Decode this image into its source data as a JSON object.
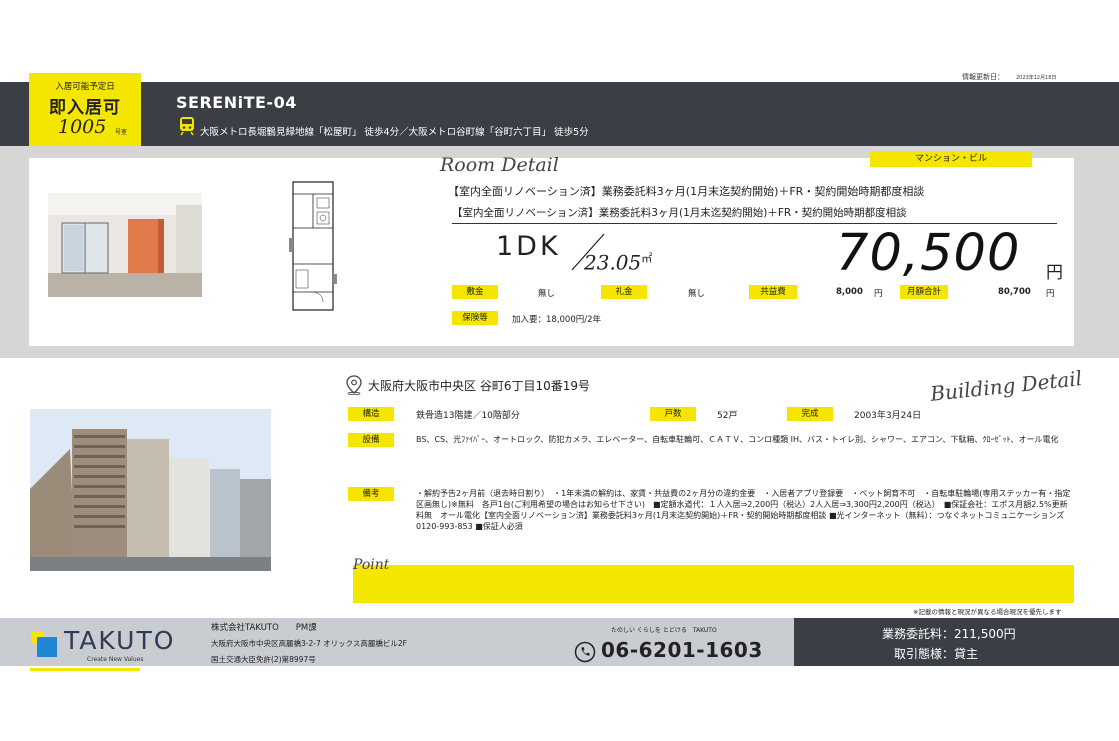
{
  "header": {
    "update_label": "情報更新日：",
    "update_date": "2023年12月18日",
    "property_name": "SERENiTE-04",
    "access": "大阪メトロ長堀鶴見緑地線「松屋町」 徒歩4分／大阪メトロ谷町線「谷町六丁目」 徒歩5分"
  },
  "badge": {
    "label": "入居可能予定日",
    "status": "即入居可",
    "room_number": "1005",
    "room_suffix": "号室"
  },
  "room": {
    "section_title": "Room Detail",
    "building_type": "マンション・ビル",
    "catch_line_1": "【室内全面リノベーション済】業務委託料3ヶ月(1月末迄契約開始)＋FR・契約開始時期都度相談",
    "catch_line_2": "【室内全面リノベーション済】業務委託料3ヶ月(1月末迄契約開始)＋FR・契約開始時期都度相談",
    "layout": "1DK",
    "area": "23.05",
    "area_unit": "㎡",
    "rent": "70,500",
    "rent_unit": "円",
    "fees": {
      "deposit_label": "敷金",
      "deposit_value": "無し",
      "key_money_label": "礼金",
      "key_money_value": "無し",
      "common_fee_label": "共益費",
      "common_fee_value": "8,000",
      "common_fee_unit": "円",
      "monthly_total_label": "月額合計",
      "monthly_total_value": "80,700",
      "monthly_total_unit": "円",
      "insurance_label": "保険等",
      "insurance_value": "加入要：18,000円/2年"
    }
  },
  "building": {
    "section_title": "Building Detail",
    "address": "大阪府大阪市中央区 谷町6丁目10番19号",
    "structure_label": "構造",
    "structure_value": "鉄骨造13階建／10階部分",
    "units_label": "戸数",
    "units_value": "52戸",
    "built_label": "完成",
    "built_value": "2003年3月24日",
    "facilities_label": "設備",
    "facilities_value": "BS、CS、光ﾌｧｲﾊﾞｰ、オートロック、防犯カメラ、エレベーター、自転車駐輪可、ＣＡＴＶ、コンロ種類 IH、バス・トイレ別、シャワー、エアコン、下駄箱、ｸﾛｰｾﾞｯﾄ、オール電化",
    "notes_label": "備考",
    "notes_value": "・解約予告2ヶ月前（退去時日割り）　・1年未満の解約は、家賃・共益費の2ヶ月分の違約金要　・入居者アプリ登録要　・ペット飼育不可　・自転車駐輪場(専用ステッカー有・指定区画無し)※無料　各戸1台(ご利用希望の場合はお知らせ下さい)　■定額水道代：１人入居⇒2,200円（税込）2人入居⇒3,300円2,200円（税込）　■保証会社：エポス月額2.5%更新料無　オール電化【室内全面リノベーション済】業務委託料3ヶ月(1月末迄契約開始)＋FR・契約開始時期都度相談 ■光インターネット（無料）：つなぐネットコミュニケーションズ　0120-993-853 ■保証人必須",
    "point_label": "Point",
    "disclaimer": "※記載の情報と現況が異なる場合現況を優先します"
  },
  "footer": {
    "logo_text": "TAKUTO",
    "logo_tagline": "Create New Values",
    "company": "株式会社TAKUTO　　PM課",
    "company_address": "大阪府大阪市中央区高麗橋3-2-7 オリックス高麗橋ビル2F",
    "license": "国土交通大臣免許(2)第8997号",
    "slogan": "たのしい くらしを とどける　TAKUTO",
    "phone": "06-6201-1603",
    "commission": "業務委託料：211,500円",
    "deal_type": "取引態様：貸主"
  },
  "colors": {
    "accent_yellow": "#f5e600",
    "header_dark": "#3b3f45",
    "footer_gray": "#c9cdd2"
  }
}
